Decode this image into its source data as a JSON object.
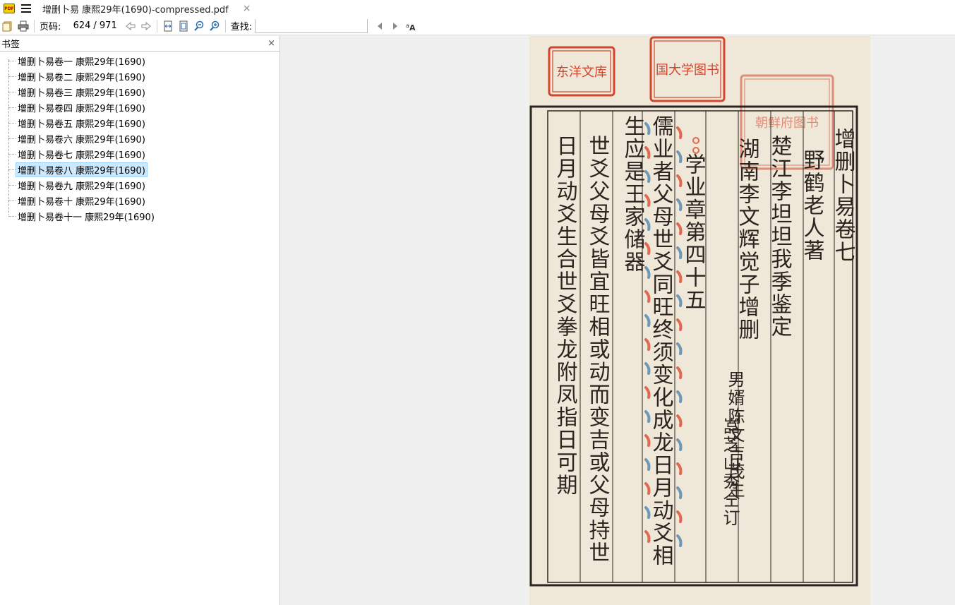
{
  "window": {
    "app_icon_label": "PDF",
    "tab_title": "增删卜易  康熙29年(1690)-compressed.pdf",
    "tab_close": "×"
  },
  "toolbar": {
    "page_label": "页码:",
    "current_page": "624",
    "total_pages": "/ 971",
    "search_label": "查找:",
    "search_value": "",
    "icons": [
      "open-file-icon",
      "print-icon",
      "back-icon",
      "forward-icon",
      "fit-width-icon",
      "fit-page-icon",
      "zoom-out-icon",
      "zoom-in-icon",
      "find-prev-icon",
      "find-next-icon",
      "match-case-icon"
    ]
  },
  "sidebar": {
    "title": "书签",
    "close": "×",
    "selected_index": 7,
    "items": [
      {
        "label": "增删卜易卷一 康熙29年(1690)"
      },
      {
        "label": "增删卜易卷二 康熙29年(1690)"
      },
      {
        "label": "增删卜易卷三 康熙29年(1690)"
      },
      {
        "label": "增删卜易卷四 康熙29年(1690)"
      },
      {
        "label": "增删卜易卷五 康熙29年(1690)"
      },
      {
        "label": "增删卜易卷六 康熙29年(1690)"
      },
      {
        "label": "增删卜易卷七 康熙29年(1690)"
      },
      {
        "label": "增删卜易卷八 康熙29年(1690)"
      },
      {
        "label": "增删卜易卷九 康熙29年(1690)"
      },
      {
        "label": "增删卜易卷十 康熙29年(1690)"
      },
      {
        "label": "增删卜易卷十一 康熙29年(1690)"
      }
    ]
  },
  "document": {
    "columns": [
      "增删卜易卷七",
      "野鹤老人著",
      "楚江李坦坦我季鉴定",
      "湖南李文辉觉子增删",
      "男婿陈文吉茂生",
      "嵓芝山秀仝订",
      "学业章第四十五",
      "儒业者父母世爻同旺终须变化成龙日月动爻相",
      "生应是王家储器",
      "世爻父母爻皆宜旺相或动而变吉或父母持世",
      "日月动爻生合世爻拳龙附凤指日可期"
    ],
    "seals": [
      "东洋文库",
      "国大学图书",
      "朝鲜府图书"
    ],
    "colors": {
      "paper": "#efe7d7",
      "ink": "#2a2520",
      "seal_red": "#d2462e",
      "annot_red": "#e06a50",
      "annot_blue": "#6e98b8"
    }
  }
}
